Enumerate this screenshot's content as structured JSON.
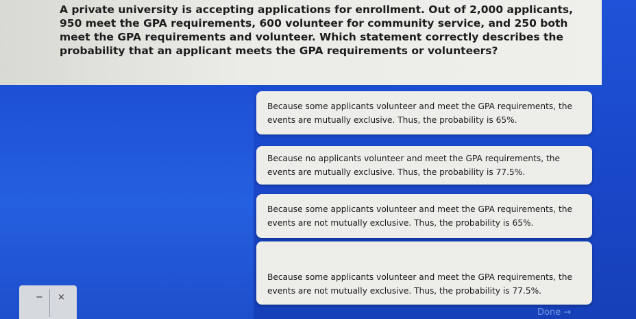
{
  "question": {
    "text": "A private university is accepting applications for enrollment. Out of 2,000 applicants, 950 meet the GPA requirements, 600 volunteer for community service, and 250 both meet the GPA requirements and volunteer. Which statement correctly describes the probability that an applicant meets the GPA requirements or volunteers?"
  },
  "answers": [
    {
      "label": "Because some applicants volunteer and meet the GPA requirements, the events are mutually exclusive. Thus, the probability is 65%."
    },
    {
      "label": "Because no applicants volunteer and meet the GPA requirements, the events are mutually exclusive. Thus, the probability is 77.5%."
    },
    {
      "label": "Because some applicants volunteer and meet the GPA requirements, the events are not mutually exclusive. Thus, the probability is 65%."
    },
    {
      "label": "Because some applicants volunteer and meet the GPA requirements, the events are not mutually exclusive. Thus, the probability is 77.5%."
    }
  ],
  "calculator": {
    "minus_symbol": "−",
    "times_symbol": "×"
  },
  "footer": {
    "done_label": "Done →"
  },
  "colors": {
    "background": "#1f52d8",
    "panel": "#ebebe7",
    "option": "#ededea",
    "text": "#1a1a1a"
  }
}
